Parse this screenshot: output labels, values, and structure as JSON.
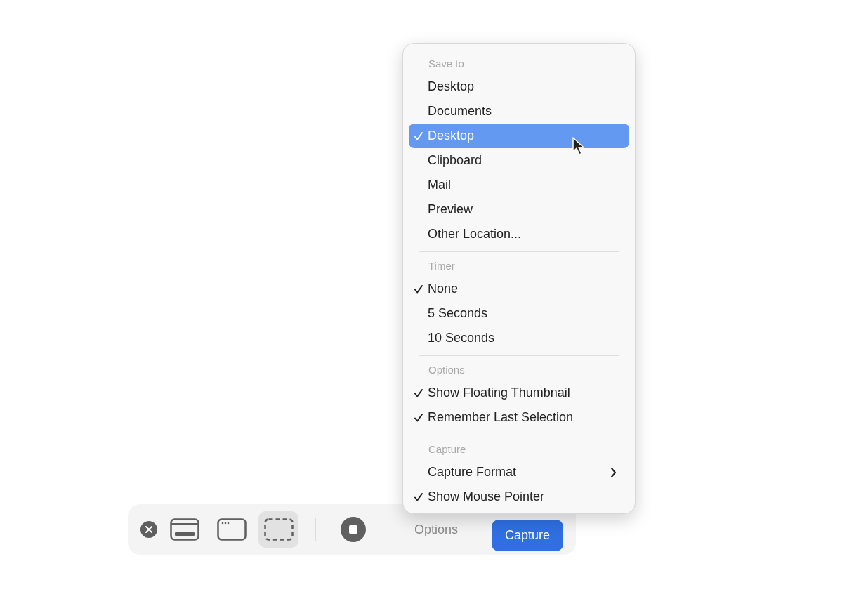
{
  "toolbar": {
    "tools": [
      {
        "kind": "close",
        "selected": false
      },
      {
        "kind": "screen",
        "selected": false
      },
      {
        "kind": "window",
        "selected": false
      },
      {
        "kind": "selection",
        "selected": true
      },
      {
        "kind": "divider"
      },
      {
        "kind": "record",
        "selected": false
      },
      {
        "kind": "divider"
      }
    ],
    "options_label": "Options",
    "capture_label": "Capture"
  },
  "menu": {
    "sections": [
      {
        "header": "Save to",
        "items": [
          {
            "label": "Desktop",
            "checked": false,
            "selected": false
          },
          {
            "label": "Documents",
            "checked": false,
            "selected": false
          },
          {
            "label": "Desktop",
            "checked": true,
            "selected": true
          },
          {
            "label": "Clipboard",
            "checked": false,
            "selected": false
          },
          {
            "label": "Mail",
            "checked": false,
            "selected": false
          },
          {
            "label": "Preview",
            "checked": false,
            "selected": false
          },
          {
            "label": "Other Location...",
            "checked": false,
            "selected": false
          }
        ]
      },
      {
        "header": "Timer",
        "items": [
          {
            "label": "None",
            "checked": true,
            "selected": false
          },
          {
            "label": "5 Seconds",
            "checked": false,
            "selected": false
          },
          {
            "label": "10 Seconds",
            "checked": false,
            "selected": false
          }
        ]
      },
      {
        "header": "Options",
        "items": [
          {
            "label": "Show Floating Thumbnail",
            "checked": true,
            "selected": false
          },
          {
            "label": "Remember Last Selection",
            "checked": true,
            "selected": false
          }
        ]
      },
      {
        "header": "Capture",
        "items": [
          {
            "label": "Capture Format",
            "checked": false,
            "selected": false,
            "kind": "submenu"
          },
          {
            "label": "Show Mouse Pointer",
            "checked": true,
            "selected": false
          }
        ]
      }
    ]
  }
}
